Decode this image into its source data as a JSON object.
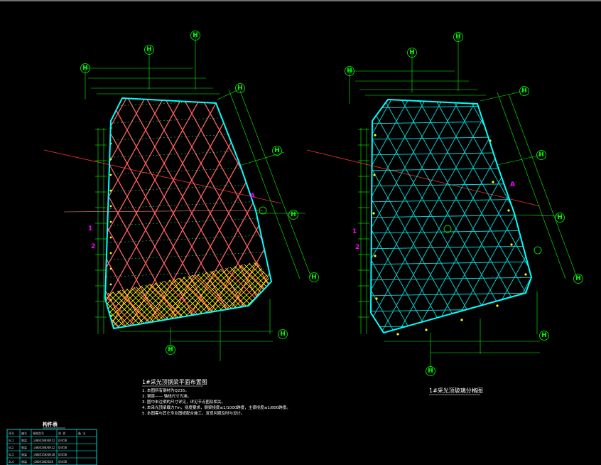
{
  "drawings": [
    {
      "title": "1#采光顶钢梁平面布置图",
      "grid_labels": [
        "H",
        "H",
        "H",
        "H",
        "H",
        "H",
        "H",
        "H",
        "H"
      ],
      "markers": [
        "1",
        "2",
        "A"
      ]
    },
    {
      "title": "1#采光顶玻璃分格图",
      "grid_labels": [
        "H",
        "H",
        "H",
        "H",
        "H",
        "H",
        "H",
        "H",
        "H"
      ],
      "markers": [
        "1",
        "2",
        "A"
      ]
    }
  ],
  "notes": [
    "1. 本图所有钢材为Q235。",
    "2. 钢梁—— 轴线尺寸为准。",
    "3. 图中未注明的尺寸详见，详见节点图及相关。",
    "4. 本采光顶承载力7m，挠度要求，钢梁挠度≤1/1000跨度，主梁挠度≤1/800跨度。",
    "5. 本图需与其它专业图纸配合施工，发现问题及时与设计。"
  ],
  "table": {
    "title": "构件表",
    "headers": [
      "序号",
      "编号",
      "规格型号",
      "材 质",
      "备 注"
    ],
    "rows": [
      [
        "GL1",
        "钢梁",
        "□300X200X8X12",
        "Q345B",
        ""
      ],
      [
        "GL2",
        "钢梁",
        "□300X200X8X12",
        "Q345B",
        ""
      ],
      [
        "GL3",
        "钢梁",
        "□300X150X8X10",
        "Q345B",
        ""
      ],
      [
        "GL4",
        "钢梁",
        "□200X100X6X8",
        "Q345B",
        ""
      ]
    ]
  },
  "colors": {
    "background": "#000000",
    "grid": "#00ff00",
    "beam": "#ff6060",
    "outline": "#00ffff",
    "hatch": "#ffff00",
    "glass": "#00e0e0",
    "axis": "#ff3030",
    "marker": "#ff00ff",
    "dimension": "#c8c8c8"
  }
}
